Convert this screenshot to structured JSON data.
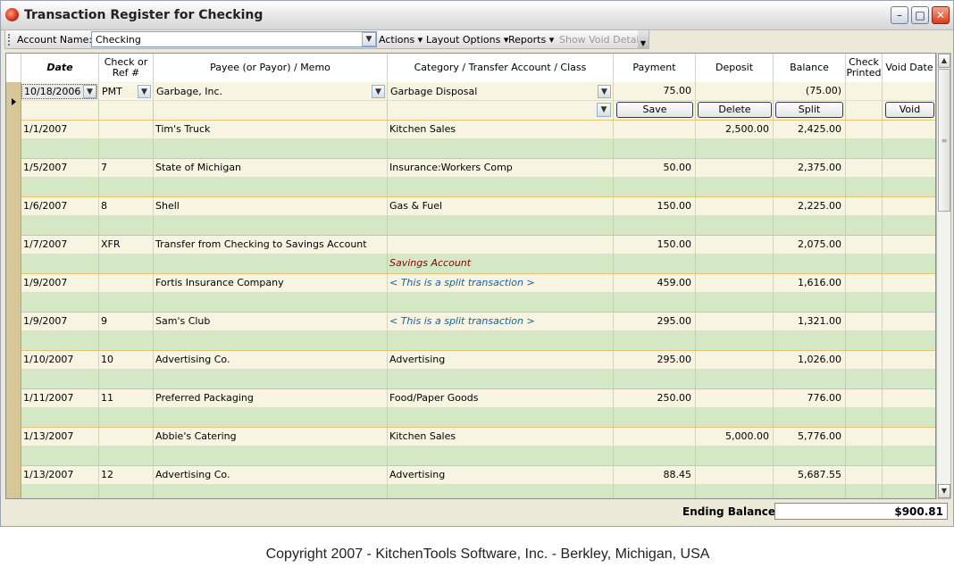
{
  "window": {
    "title": "Transaction Register for Checking"
  },
  "toolbar": {
    "account_label": "Account Name:",
    "account_value": "Checking",
    "menus": [
      "Actions ▾",
      "Layout Options ▾",
      "Reports ▾"
    ],
    "show_void_details": "Show Void Details"
  },
  "columns": {
    "date": "Date",
    "checkref": "Check or Ref #",
    "payee": "Payee (or Payor) / Memo",
    "category": "Category / Transfer Account / Class",
    "payment": "Payment",
    "deposit": "Deposit",
    "balance": "Balance",
    "printed": "Check Printed",
    "voiddate": "Void Date"
  },
  "editing_row": {
    "date": "10/18/2006",
    "ref": "PMT",
    "payee": "Garbage, Inc.",
    "category": "Garbage Disposal",
    "payment": "75.00",
    "deposit": "",
    "balance": "(75.00)",
    "buttons": {
      "save": "Save",
      "delete": "Delete",
      "split": "Split",
      "void": "Void"
    }
  },
  "rows": [
    {
      "date": "1/1/2007",
      "ref": "",
      "payee": "Tim's Truck",
      "category": "Kitchen Sales",
      "payment": "",
      "deposit": "2,500.00",
      "balance": "2,425.00",
      "memo_category": "",
      "memo_style": ""
    },
    {
      "date": "1/5/2007",
      "ref": "7",
      "payee": "State of Michigan",
      "category": "Insurance:Workers Comp",
      "payment": "50.00",
      "deposit": "",
      "balance": "2,375.00",
      "memo_category": "",
      "memo_style": ""
    },
    {
      "date": "1/6/2007",
      "ref": "8",
      "payee": "Shell",
      "category": "Gas & Fuel",
      "payment": "150.00",
      "deposit": "",
      "balance": "2,225.00",
      "memo_category": "",
      "memo_style": ""
    },
    {
      "date": "1/7/2007",
      "ref": "XFR",
      "payee": "Transfer from Checking to Savings Account",
      "category": "",
      "payment": "150.00",
      "deposit": "",
      "balance": "2,075.00",
      "memo_category": "Savings Account",
      "memo_style": "savings"
    },
    {
      "date": "1/9/2007",
      "ref": "",
      "payee": "Fortis Insurance Company",
      "category": "< This is a split transaction >",
      "category_style": "split",
      "payment": "459.00",
      "deposit": "",
      "balance": "1,616.00",
      "memo_category": "",
      "memo_style": ""
    },
    {
      "date": "1/9/2007",
      "ref": "9",
      "payee": "Sam's Club",
      "category": "< This is a split transaction >",
      "category_style": "split",
      "payment": "295.00",
      "deposit": "",
      "balance": "1,321.00",
      "memo_category": "",
      "memo_style": ""
    },
    {
      "date": "1/10/2007",
      "ref": "10",
      "payee": "Advertising Co.",
      "category": "Advertising",
      "payment": "295.00",
      "deposit": "",
      "balance": "1,026.00",
      "memo_category": "",
      "memo_style": ""
    },
    {
      "date": "1/11/2007",
      "ref": "11",
      "payee": "Preferred Packaging",
      "category": "Food/Paper Goods",
      "payment": "250.00",
      "deposit": "",
      "balance": "776.00",
      "memo_category": "",
      "memo_style": ""
    },
    {
      "date": "1/13/2007",
      "ref": "",
      "payee": "Abbie's Catering",
      "category": "Kitchen Sales",
      "payment": "",
      "deposit": "5,000.00",
      "balance": "5,776.00",
      "memo_category": "",
      "memo_style": ""
    },
    {
      "date": "1/13/2007",
      "ref": "12",
      "payee": "Advertising Co.",
      "category": "Advertising",
      "payment": "88.45",
      "deposit": "",
      "balance": "5,687.55",
      "memo_category": "",
      "memo_style": ""
    }
  ],
  "footer": {
    "ending_balance_label": "Ending Balance:",
    "ending_balance_value": "$900.81"
  },
  "copyright": "Copyright 2007 - KitchenTools Software, Inc. - Berkley, Michigan, USA",
  "icons": {
    "app": "app-logo-icon",
    "dropdown": "chevron-down-icon",
    "row_pointer": "current-row-arrow-icon"
  }
}
